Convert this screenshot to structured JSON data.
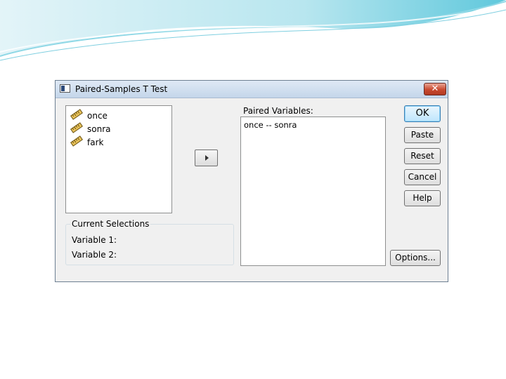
{
  "dialog": {
    "title": "Paired-Samples T Test",
    "close_label": "✕"
  },
  "source_variables": [
    {
      "label": "once",
      "icon": "scale-variable-icon"
    },
    {
      "label": "sonra",
      "icon": "scale-variable-icon"
    },
    {
      "label": "fark",
      "icon": "scale-variable-icon"
    }
  ],
  "paired": {
    "label": "Paired Variables:",
    "items": [
      "once -- sonra"
    ]
  },
  "current_selections": {
    "legend": "Current Selections",
    "variable1_label": "Variable 1:",
    "variable2_label": "Variable 2:"
  },
  "buttons": {
    "ok": "OK",
    "paste": "Paste",
    "reset": "Reset",
    "cancel": "Cancel",
    "help": "Help",
    "options": "Options..."
  },
  "colors": {
    "slide_accent": "#5bc3d9",
    "dialog_background": "#f0f0f0",
    "close_button": "#c8492f"
  }
}
